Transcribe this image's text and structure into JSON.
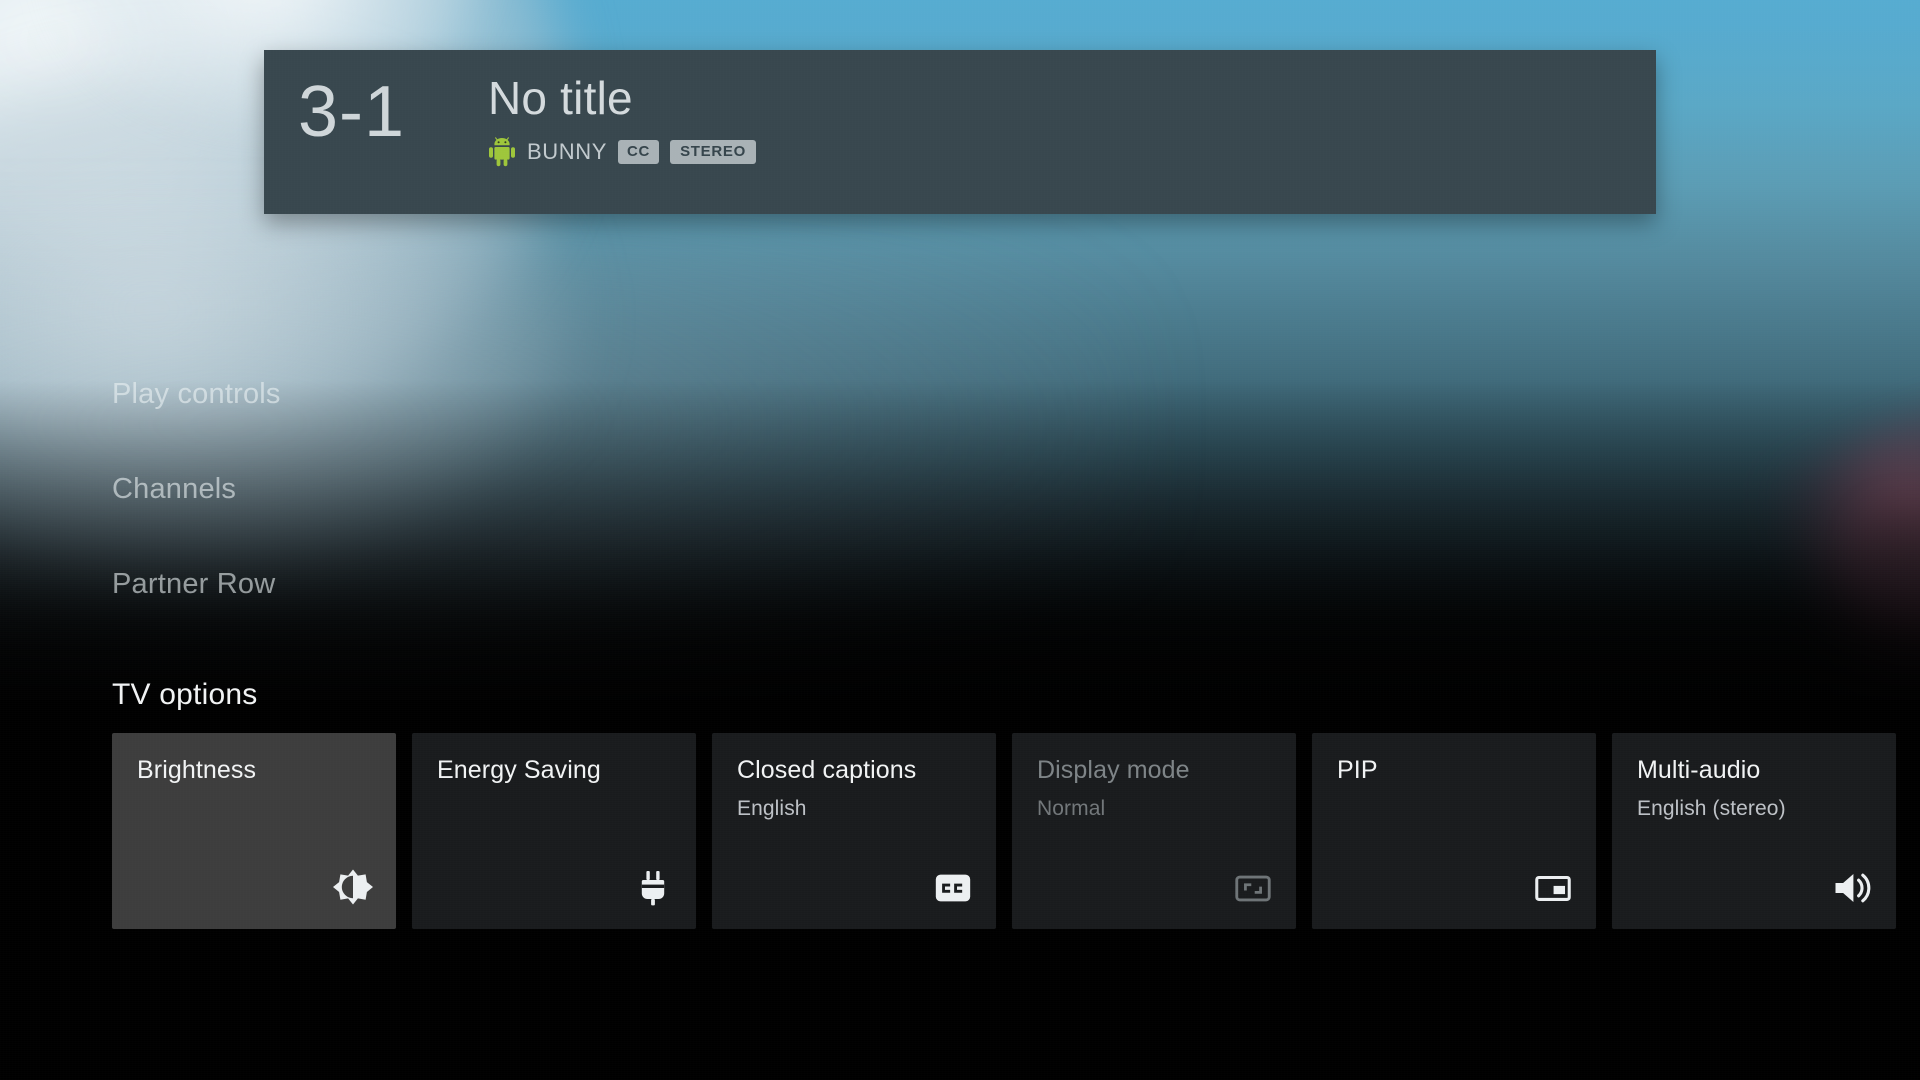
{
  "banner": {
    "channel_number": "3-1",
    "title": "No title",
    "source_icon": "android-robot-icon",
    "source_label": "BUNNY",
    "badges": [
      {
        "label": "CC",
        "name": "closed-caption-badge"
      },
      {
        "label": "STEREO",
        "name": "stereo-audio-badge"
      }
    ]
  },
  "menu": {
    "items": [
      {
        "label": "Play controls",
        "name": "menu-item-play-controls"
      },
      {
        "label": "Channels",
        "name": "menu-item-channels"
      },
      {
        "label": "Partner Row",
        "name": "menu-item-partner-row"
      }
    ]
  },
  "tv_options": {
    "section_title": "TV options",
    "cards": [
      {
        "title": "Brightness",
        "subtitle": "",
        "icon": "brightness-icon",
        "state": "focused"
      },
      {
        "title": "Energy Saving",
        "subtitle": "",
        "icon": "power-plug-icon",
        "state": "normal"
      },
      {
        "title": "Closed captions",
        "subtitle": "English",
        "icon": "closed-caption-icon",
        "state": "normal"
      },
      {
        "title": "Display mode",
        "subtitle": "Normal",
        "icon": "aspect-ratio-icon",
        "state": "disabled"
      },
      {
        "title": "PIP",
        "subtitle": "",
        "icon": "picture-in-picture-icon",
        "state": "normal"
      },
      {
        "title": "Multi-audio",
        "subtitle": "English (stereo)",
        "icon": "volume-up-icon",
        "state": "normal"
      }
    ]
  },
  "colors": {
    "banner_bg": "#38474e",
    "banner_text": "#d4dadd",
    "badge_bg": "#a9b2b6",
    "badge_text": "#36454c",
    "card_bg": "#191b1d",
    "card_focused_bg": "#3d3d3d",
    "card_title": "#f1f3f4",
    "card_subtitle": "#bdc1c6",
    "card_disabled_text": "#7e8487",
    "menu_text": "rgba(235,241,244,0.60)",
    "page_bg": "#000000",
    "sky_top": "#57aed3"
  }
}
